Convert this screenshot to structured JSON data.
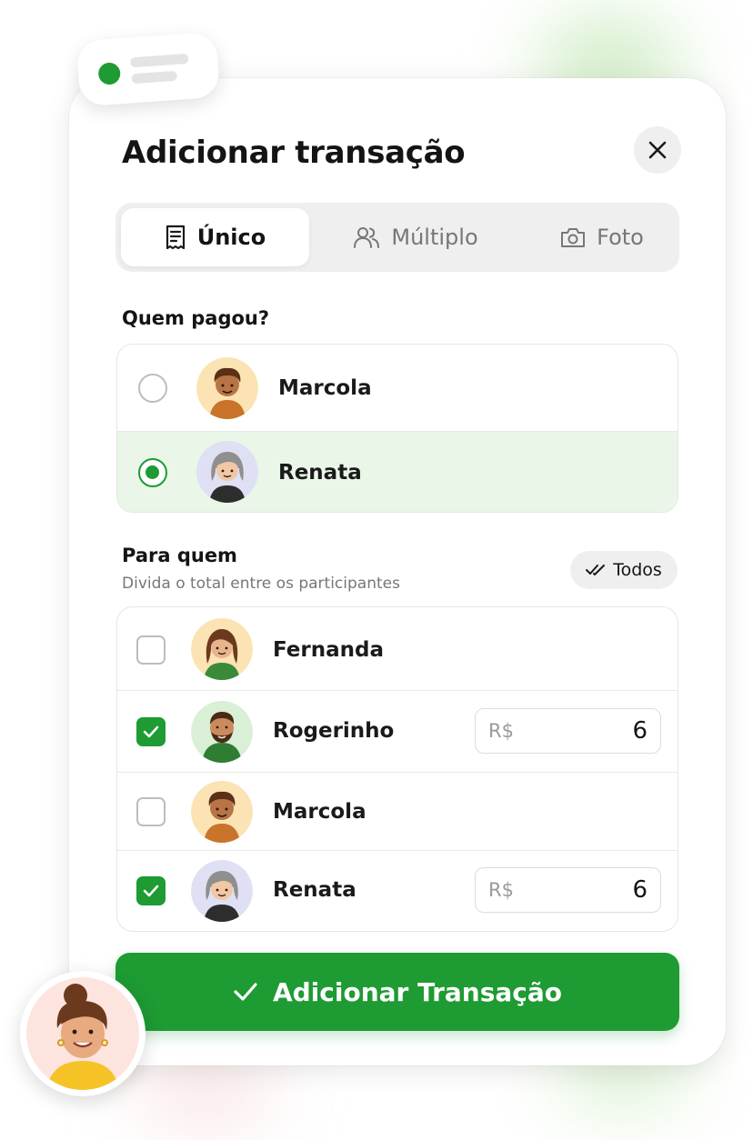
{
  "dialog": {
    "title": "Adicionar transação"
  },
  "tabs": [
    {
      "label": "Único",
      "icon": "receipt-icon",
      "active": true
    },
    {
      "label": "Múltiplo",
      "icon": "users-icon",
      "active": false
    },
    {
      "label": "Foto",
      "icon": "camera-icon",
      "active": false
    }
  ],
  "payer": {
    "label": "Quem pagou?",
    "options": [
      {
        "name": "Marcola",
        "selected": false
      },
      {
        "name": "Renata",
        "selected": true
      }
    ]
  },
  "split": {
    "label": "Para quem",
    "subtitle": "Divida o total entre os participantes",
    "select_all_label": "Todos",
    "participants": [
      {
        "name": "Fernanda",
        "checked": false
      },
      {
        "name": "Rogerinho",
        "checked": true,
        "currency": "R$",
        "amount": "6"
      },
      {
        "name": "Marcola",
        "checked": false
      },
      {
        "name": "Renata",
        "checked": true,
        "currency": "R$",
        "amount": "6"
      }
    ]
  },
  "submit": {
    "label": "Adicionar Transação"
  },
  "colors": {
    "accent": "#1e9b33",
    "selected_row_bg": "#e9f6e8",
    "tab_bg": "#efefef"
  }
}
